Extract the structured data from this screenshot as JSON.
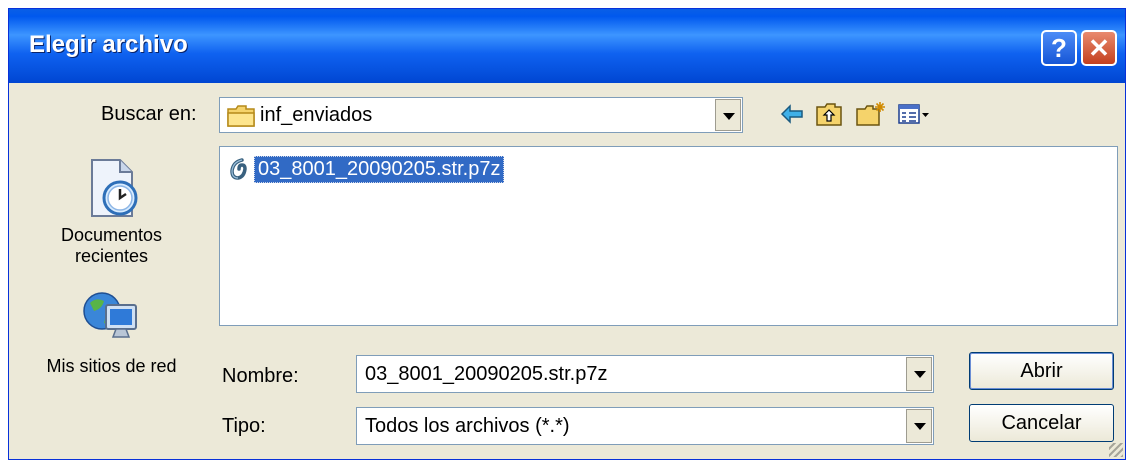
{
  "window": {
    "title": "Elegir archivo"
  },
  "titlebar": {
    "help_label": "?",
    "close_label": "✕"
  },
  "lookin": {
    "label": "Buscar en:",
    "value": "inf_enviados"
  },
  "toolbar": {
    "icons": [
      "back-icon",
      "up-folder-icon",
      "new-folder-icon",
      "view-menu-icon"
    ]
  },
  "places": [
    {
      "label_line1": "Documentos",
      "label_line2": "recientes",
      "icon": "recent-documents-icon"
    },
    {
      "label_line1": "Mis sitios de red",
      "label_line2": "",
      "icon": "network-places-icon"
    }
  ],
  "files": [
    {
      "name": "03_8001_20090205.str.p7z",
      "icon": "p7z-file-icon",
      "selected": true
    }
  ],
  "filename": {
    "label": "Nombre:",
    "value": "03_8001_20090205.str.p7z"
  },
  "filetype": {
    "label": "Tipo:",
    "value": "Todos los archivos (*.*)"
  },
  "buttons": {
    "open": "Abrir",
    "cancel": "Cancelar"
  },
  "colors": {
    "titlebar": "#0058ee",
    "selection": "#316ac5",
    "dialog_bg": "#ece9d8"
  }
}
